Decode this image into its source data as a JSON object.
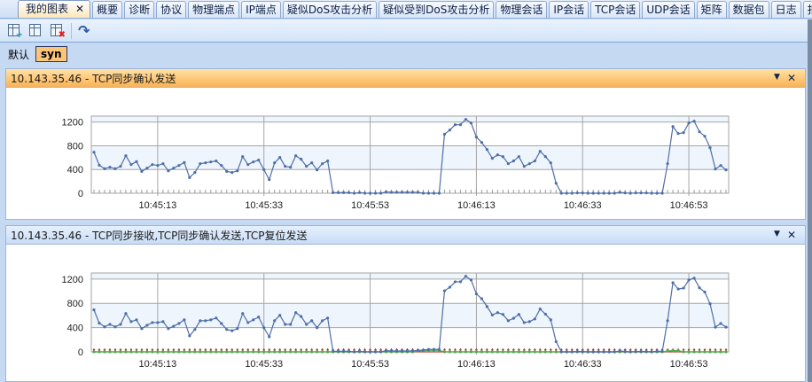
{
  "tabs": [
    {
      "label": "我的图表",
      "active": true,
      "close": "✕"
    },
    {
      "label": "概要"
    },
    {
      "label": "诊断"
    },
    {
      "label": "协议"
    },
    {
      "label": "物理端点"
    },
    {
      "label": "IP端点"
    },
    {
      "label": "疑似DoS攻击分析"
    },
    {
      "label": "疑似受到DoS攻击分析"
    },
    {
      "label": "物理会话"
    },
    {
      "label": "IP会话"
    },
    {
      "label": "TCP会话"
    },
    {
      "label": "UDP会话"
    },
    {
      "label": "矩阵"
    },
    {
      "label": "数据包"
    },
    {
      "label": "日志"
    },
    {
      "label": "报表"
    }
  ],
  "toolbar": {
    "icons": [
      "add-chart-icon",
      "edit-chart-icon",
      "delete-chart-icon",
      "refresh-icon"
    ]
  },
  "views": {
    "default_label": "默认",
    "selected_label": "syn"
  },
  "colors": {
    "line": "#4f6fa8",
    "band": "#eef5fd",
    "grid": "#a6a6a6",
    "red_series": "#c0392b",
    "green_series": "#4caf50",
    "active_header": "#fbb254"
  },
  "chart_data": [
    {
      "type": "line",
      "title": "10.143.35.46 - TCP同步确认发送",
      "ylim": [
        0,
        1300
      ],
      "yticks": [
        0,
        400,
        800,
        1200
      ],
      "xticks": [
        "10:45:13",
        "10:45:33",
        "10:45:53",
        "10:46:13",
        "10:46:33",
        "10:46:53"
      ],
      "grid": true,
      "x_start": "10:45:01",
      "x_end": "10:47:00",
      "x_step_seconds": 1,
      "series": [
        {
          "color": "#4f6fa8",
          "values": [
            692,
            473,
            413,
            438,
            413,
            453,
            632,
            483,
            533,
            368,
            423,
            483,
            468,
            498,
            378,
            423,
            468,
            518,
            264,
            349,
            498,
            513,
            528,
            543,
            468,
            368,
            349,
            378,
            617,
            483,
            528,
            558,
            398,
            229,
            513,
            603,
            453,
            438,
            632,
            573,
            453,
            513,
            393,
            498,
            543,
            10,
            10,
            10,
            10,
            0,
            10,
            0,
            0,
            0,
            0,
            20,
            15,
            15,
            15,
            15,
            15,
            15,
            0,
            0,
            0,
            0,
            995,
            1065,
            1155,
            1155,
            1245,
            1185,
            946,
            856,
            737,
            588,
            647,
            617,
            498,
            543,
            617,
            453,
            498,
            543,
            707,
            617,
            513,
            169,
            0,
            0,
            0,
            5,
            5,
            0,
            0,
            0,
            0,
            0,
            0,
            15,
            5,
            0,
            5,
            5,
            5,
            0,
            0,
            0,
            498,
            1125,
            1006,
            1021,
            1185,
            1215,
            1036,
            961,
            767,
            408,
            468,
            393
          ]
        }
      ]
    },
    {
      "type": "line",
      "title": "10.143.35.46 - TCP同步接收,TCP同步确认发送,TCP复位发送",
      "ylim": [
        0,
        1300
      ],
      "yticks": [
        0,
        400,
        800,
        1200
      ],
      "xticks": [
        "10:45:13",
        "10:45:33",
        "10:45:53",
        "10:46:13",
        "10:46:33",
        "10:46:53"
      ],
      "grid": true,
      "x_start": "10:45:01",
      "x_end": "10:47:00",
      "x_step_seconds": 1,
      "series": [
        {
          "color": "#c0392b",
          "values": [
            0,
            0,
            0,
            0,
            0,
            0,
            0,
            0,
            0,
            0,
            0,
            0,
            0,
            0,
            0,
            0,
            0,
            0,
            0,
            0,
            0,
            0,
            0,
            0,
            0,
            0,
            0,
            0,
            0,
            0,
            0,
            0,
            0,
            0,
            0,
            0,
            0,
            0,
            0,
            0,
            0,
            0,
            0,
            0,
            0,
            0,
            0,
            0,
            0,
            0,
            0,
            0,
            0,
            0,
            0,
            0,
            0,
            0,
            0,
            0,
            0,
            0,
            0,
            0,
            0,
            0,
            0,
            0,
            0,
            0,
            0,
            0,
            0,
            0,
            0,
            0,
            0,
            0,
            0,
            0,
            0,
            0,
            0,
            0,
            0,
            0,
            0,
            0,
            0,
            0,
            0,
            0,
            0,
            0,
            0,
            0,
            0,
            0,
            0,
            0,
            0,
            0,
            0,
            0,
            0,
            0,
            0,
            0,
            0,
            0,
            0,
            0,
            0,
            0,
            0,
            0,
            0,
            0,
            0,
            0
          ]
        },
        {
          "color": "#4caf50",
          "values": [
            0,
            0,
            0,
            0,
            0,
            0,
            0,
            0,
            0,
            0,
            0,
            0,
            0,
            0,
            0,
            0,
            0,
            0,
            0,
            0,
            0,
            0,
            0,
            0,
            0,
            0,
            0,
            0,
            0,
            0,
            0,
            0,
            0,
            0,
            0,
            0,
            0,
            0,
            0,
            0,
            0,
            0,
            0,
            0,
            0,
            0,
            0,
            0,
            0,
            0,
            0,
            0,
            0,
            0,
            0,
            0,
            0,
            0,
            0,
            0,
            0,
            15,
            20,
            25,
            25,
            25,
            0,
            0,
            0,
            0,
            0,
            0,
            0,
            0,
            0,
            0,
            0,
            0,
            0,
            0,
            0,
            0,
            0,
            0,
            0,
            0,
            0,
            0,
            0,
            0,
            0,
            0,
            0,
            0,
            0,
            0,
            0,
            0,
            0,
            0,
            0,
            0,
            0,
            0,
            0,
            0,
            0,
            0,
            15,
            20,
            20,
            0,
            0,
            0,
            0,
            0,
            0,
            0,
            0,
            0
          ]
        },
        {
          "color": "#4f6fa8",
          "values": [
            692,
            473,
            413,
            453,
            413,
            453,
            632,
            498,
            528,
            383,
            438,
            483,
            483,
            498,
            383,
            423,
            468,
            528,
            264,
            368,
            513,
            513,
            528,
            558,
            468,
            368,
            349,
            383,
            632,
            483,
            528,
            573,
            398,
            249,
            513,
            603,
            453,
            453,
            647,
            583,
            453,
            513,
            398,
            513,
            558,
            10,
            10,
            10,
            10,
            0,
            10,
            0,
            0,
            0,
            0,
            20,
            15,
            15,
            15,
            15,
            15,
            25,
            30,
            40,
            40,
            40,
            1006,
            1065,
            1155,
            1155,
            1245,
            1185,
            956,
            876,
            747,
            608,
            647,
            617,
            513,
            553,
            617,
            483,
            498,
            543,
            707,
            622,
            528,
            169,
            0,
            0,
            0,
            5,
            5,
            0,
            0,
            0,
            0,
            0,
            0,
            15,
            5,
            0,
            5,
            5,
            5,
            0,
            10,
            10,
            513,
            1140,
            1036,
            1051,
            1185,
            1215,
            1056,
            986,
            792,
            408,
            468,
            408
          ]
        }
      ]
    }
  ]
}
